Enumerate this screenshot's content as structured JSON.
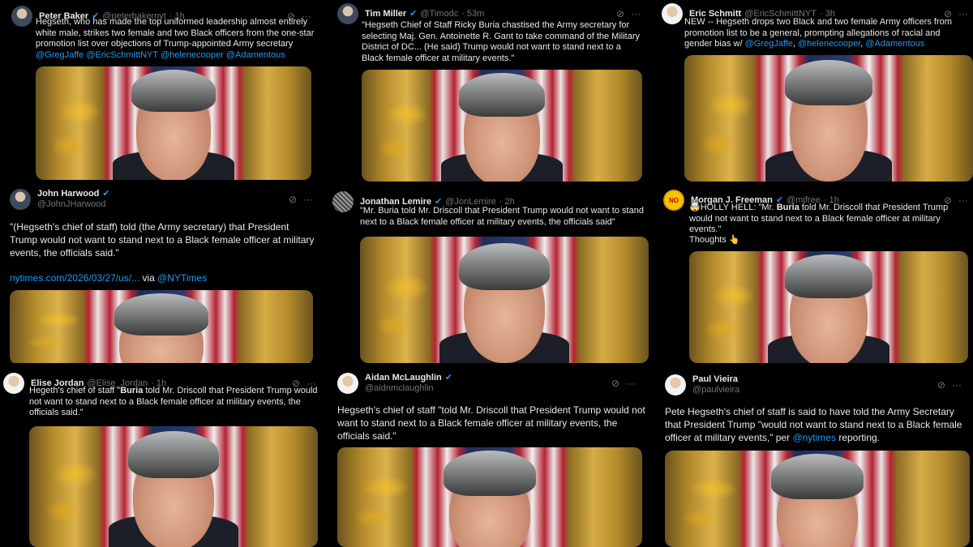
{
  "tweets": [
    {
      "name": "Peter Baker",
      "handle": "@peterbakernyt",
      "time": "· 1h",
      "verified": true,
      "text": "Hegseth, who has made the top uniformed leadership almost entirely white male, strikes two female and two Black officers from the one-star promotion list over objections of Trump-appointed Army secretary",
      "links": "@GregJaffe @EricSchmittNYT @helenecooper @Adamentous",
      "icon_names": [
        "grok-icon",
        "more-icon"
      ]
    },
    {
      "name": "Tim Miller",
      "handle": "@Timodc",
      "time": "· 53m",
      "verified": true,
      "text": "\"Hegseth Chief of Staff Ricky Buria chastised the Army secretary for selecting Maj. Gen. Antoinette R. Gant to take command of the Military District of DC... (He said) Trump would not want to stand next to a Black female officer at military events.\"",
      "icon_names": [
        "grok-icon",
        "more-icon"
      ]
    },
    {
      "name": "Eric Schmitt",
      "handle": "@EricSchmittNYT",
      "time": "· 3h",
      "verified": false,
      "text": "NEW -- Hegseth drops two Black and two female Army officers from promotion list to be a general, prompting  allegations of racial and gender bias  w/",
      "links": [
        "@GregJaffe",
        "@helenecooper",
        "@Adamentous"
      ],
      "icon_names": [
        "grok-icon",
        "more-icon"
      ]
    },
    {
      "name": "John Harwood",
      "handle": "@JohnJHarwood",
      "verified": true,
      "text": "\"(Hegseth's chief of staff) told (the Army secretary) that President Trump would not want to stand next to a Black female officer at military events, the officials said.\"",
      "url": "nytimes.com/2026/03/27/us/...",
      "via": "via",
      "via_link": "@NYTimes",
      "icon_names": [
        "grok-icon",
        "more-icon"
      ]
    },
    {
      "name": "Jonathan Lemire",
      "handle": "@JonLemire",
      "time": "· 2h",
      "verified": true,
      "text": "\"Mr. Buria told Mr. Driscoll that President Trump would not want to stand next to a Black female officer at military events, the officials said\"",
      "icon_names": [
        "grok-icon",
        "more-icon"
      ]
    },
    {
      "name": "Morgan J. Freeman",
      "handle": "@mjfree",
      "time": "· 1h",
      "verified": true,
      "text_prefix": "🤯HOLLY HELL: \"Mr. ",
      "text_bold": "Buria",
      "text_rest": " told Mr. Driscoll that President Trump would not want to stand next to a Black female officer at military events.\"",
      "thoughts": "Thoughts 👆",
      "avatar_label": "NO",
      "icon_names": [
        "grok-icon",
        "more-icon"
      ]
    },
    {
      "name": "Elise Jordan",
      "handle": "@Elise_Jordan",
      "time": "· 1h",
      "verified": false,
      "text_prefix": "Hegeth's chief of staff \"",
      "text_bold": "Buria",
      "text_rest": " told Mr. Driscoll that President Trump would not want to stand next to a Black female officer at military events, the officials said.\"",
      "icon_names": [
        "grok-icon",
        "more-icon"
      ]
    },
    {
      "name": "Aidan McLaughlin",
      "handle": "@aidnmclaughlin",
      "verified": true,
      "text": "Hegseth's chief of staff \"told Mr. Driscoll that President Trump would not want to stand next to a Black female officer at military events, the officials said.\"",
      "icon_names": [
        "grok-icon",
        "more-icon"
      ]
    },
    {
      "name": "Paul Vieira",
      "handle": "@paulvieira",
      "verified": false,
      "text": "Pete Hegseth's chief of staff is said to have told the Army Secretary that President Trump \"would not want to stand next to a Black female officer at military events,\" per",
      "link": "@nytimes",
      "text_end": "reporting.",
      "icon_names": [
        "grok-icon",
        "more-icon"
      ]
    }
  ],
  "glyphs": {
    "verified": "✔",
    "grok": "⊘",
    "more": "···"
  },
  "colors": {
    "background": "#000000",
    "text": "#e7e9ea",
    "muted": "#71767b",
    "link": "#1d9bf0"
  }
}
